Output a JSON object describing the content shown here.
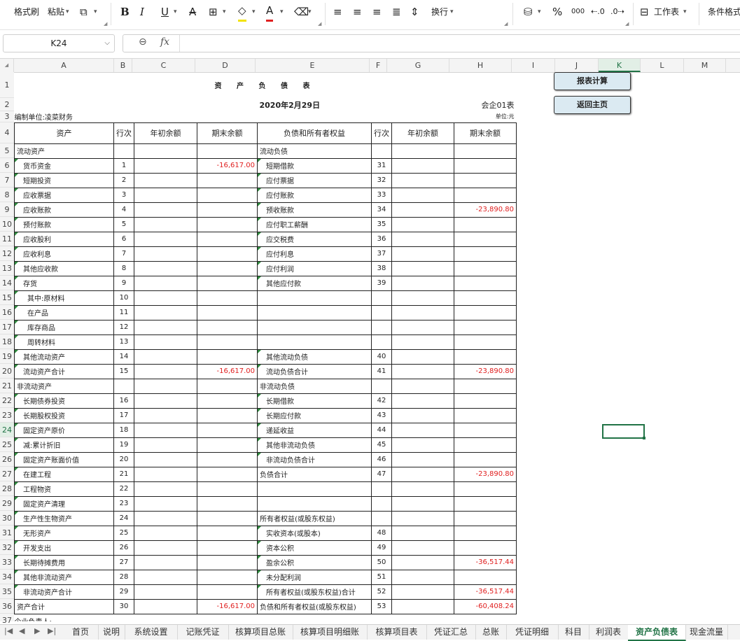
{
  "toolbar": {
    "format_painter": "格式刷",
    "paste": "粘贴",
    "wrap": "换行",
    "worksheet": "工作表",
    "conditional_format": "条件格式",
    "percent": "%",
    "thousands": "000"
  },
  "formula_bar": {
    "cell_ref": "K24",
    "fx": "fx",
    "value": ""
  },
  "columns": [
    "A",
    "B",
    "C",
    "D",
    "E",
    "F",
    "G",
    "H",
    "I",
    "J",
    "K",
    "L",
    "M"
  ],
  "rows": [
    "1",
    "2",
    "3",
    "4",
    "5",
    "6",
    "7",
    "8",
    "9",
    "10",
    "11",
    "12",
    "13",
    "14",
    "15",
    "16",
    "17",
    "18",
    "19",
    "20",
    "21",
    "22",
    "23",
    "24",
    "25",
    "26",
    "27",
    "28",
    "29",
    "30",
    "31",
    "32",
    "33",
    "34",
    "35",
    "36",
    "37"
  ],
  "report": {
    "title": "资 产 负 债 表",
    "date": "2020年2月29日",
    "form_no": "会企01表",
    "org": "编制单位:凌菜财务",
    "unit": "单位:元",
    "header": [
      "资产",
      "行次",
      "年初余额",
      "期末余额",
      "负债和所有者权益",
      "行次",
      "年初余额",
      "期末余额"
    ],
    "footer": "企业负责人:",
    "rows": [
      [
        "流动资产",
        "",
        "",
        "",
        "流动负债",
        "",
        "",
        ""
      ],
      [
        "货币资金",
        "1",
        "",
        "-16,617.00",
        "短期借款",
        "31",
        "",
        ""
      ],
      [
        "短期投资",
        "2",
        "",
        "",
        "应付票据",
        "32",
        "",
        ""
      ],
      [
        "应收票据",
        "3",
        "",
        "",
        "应付账款",
        "33",
        "",
        ""
      ],
      [
        "应收账款",
        "4",
        "",
        "",
        "预收账款",
        "34",
        "",
        "-23,890.80"
      ],
      [
        "预付账款",
        "5",
        "",
        "",
        "应付职工薪酬",
        "35",
        "",
        ""
      ],
      [
        "应收股利",
        "6",
        "",
        "",
        "应交税费",
        "36",
        "",
        ""
      ],
      [
        "应收利息",
        "7",
        "",
        "",
        "应付利息",
        "37",
        "",
        ""
      ],
      [
        "其他应收款",
        "8",
        "",
        "",
        "应付利润",
        "38",
        "",
        ""
      ],
      [
        "存货",
        "9",
        "",
        "",
        "其他应付款",
        "39",
        "",
        ""
      ],
      [
        "其中:原材料",
        "10",
        "",
        "",
        "",
        "",
        "",
        ""
      ],
      [
        "在产品",
        "11",
        "",
        "",
        "",
        "",
        "",
        ""
      ],
      [
        "库存商品",
        "12",
        "",
        "",
        "",
        "",
        "",
        ""
      ],
      [
        "周转材料",
        "13",
        "",
        "",
        "",
        "",
        "",
        ""
      ],
      [
        "其他流动资产",
        "14",
        "",
        "",
        "其他流动负债",
        "40",
        "",
        ""
      ],
      [
        "流动资产合计",
        "15",
        "",
        "-16,617.00",
        "流动负债合计",
        "41",
        "",
        "-23,890.80"
      ],
      [
        "非流动资产",
        "",
        "",
        "",
        "非流动负债",
        "",
        "",
        ""
      ],
      [
        "长期债券投资",
        "16",
        "",
        "",
        "长期借款",
        "42",
        "",
        ""
      ],
      [
        "长期股权投资",
        "17",
        "",
        "",
        "长期应付款",
        "43",
        "",
        ""
      ],
      [
        "固定资产原价",
        "18",
        "",
        "",
        "递延收益",
        "44",
        "",
        ""
      ],
      [
        "减:累计折旧",
        "19",
        "",
        "",
        "其他非流动负债",
        "45",
        "",
        ""
      ],
      [
        "固定资产账面价值",
        "20",
        "",
        "",
        "非流动负债合计",
        "46",
        "",
        ""
      ],
      [
        "在建工程",
        "21",
        "",
        "",
        "负债合计",
        "47",
        "",
        "-23,890.80"
      ],
      [
        "工程物资",
        "22",
        "",
        "",
        "",
        "",
        "",
        ""
      ],
      [
        "固定资产清理",
        "23",
        "",
        "",
        "",
        "",
        "",
        ""
      ],
      [
        "生产性生物资产",
        "24",
        "",
        "",
        "所有者权益(或股东权益)",
        "",
        "",
        ""
      ],
      [
        "无形资产",
        "25",
        "",
        "",
        "实收资本(或股本)",
        "48",
        "",
        ""
      ],
      [
        "开发支出",
        "26",
        "",
        "",
        "资本公积",
        "49",
        "",
        ""
      ],
      [
        "长期待摊费用",
        "27",
        "",
        "",
        "盈余公积",
        "50",
        "",
        "-36,517.44"
      ],
      [
        "其他非流动资产",
        "28",
        "",
        "",
        "未分配利润",
        "51",
        "",
        ""
      ],
      [
        "非流动资产合计",
        "29",
        "",
        "",
        "所有者权益(或股东权益)合计",
        "52",
        "",
        "-36,517.44"
      ],
      [
        "资产合计",
        "30",
        "",
        "-16,617.00",
        "负债和所有者权益(或股东权益)",
        "53",
        "",
        "-60,408.24"
      ]
    ]
  },
  "buttons": {
    "calc": "报表计算",
    "home": "返回主页"
  },
  "tabs": [
    "首页",
    "说明",
    "系统设置",
    "记账凭证",
    "核算项目总账",
    "核算项目明细账",
    "核算项目表",
    "凭证汇总",
    "总账",
    "凭证明细",
    "科目",
    "利润表",
    "资产负债表",
    "现金流量"
  ],
  "active_tab": "资产负债表"
}
